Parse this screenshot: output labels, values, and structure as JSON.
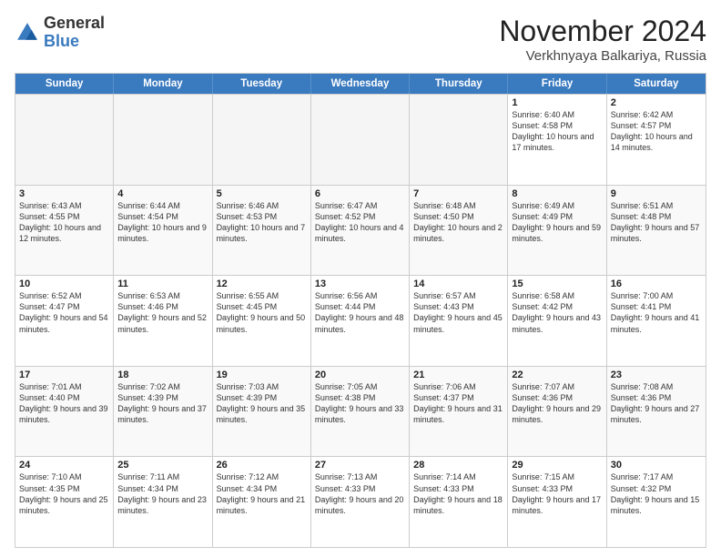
{
  "logo": {
    "general": "General",
    "blue": "Blue"
  },
  "header": {
    "month": "November 2024",
    "location": "Verkhnyaya Balkariya, Russia"
  },
  "weekdays": [
    "Sunday",
    "Monday",
    "Tuesday",
    "Wednesday",
    "Thursday",
    "Friday",
    "Saturday"
  ],
  "weeks": [
    [
      {
        "day": "",
        "info": "",
        "empty": true
      },
      {
        "day": "",
        "info": "",
        "empty": true
      },
      {
        "day": "",
        "info": "",
        "empty": true
      },
      {
        "day": "",
        "info": "",
        "empty": true
      },
      {
        "day": "",
        "info": "",
        "empty": true
      },
      {
        "day": "1",
        "info": "Sunrise: 6:40 AM\nSunset: 4:58 PM\nDaylight: 10 hours\nand 17 minutes."
      },
      {
        "day": "2",
        "info": "Sunrise: 6:42 AM\nSunset: 4:57 PM\nDaylight: 10 hours\nand 14 minutes."
      }
    ],
    [
      {
        "day": "3",
        "info": "Sunrise: 6:43 AM\nSunset: 4:55 PM\nDaylight: 10 hours\nand 12 minutes."
      },
      {
        "day": "4",
        "info": "Sunrise: 6:44 AM\nSunset: 4:54 PM\nDaylight: 10 hours\nand 9 minutes."
      },
      {
        "day": "5",
        "info": "Sunrise: 6:46 AM\nSunset: 4:53 PM\nDaylight: 10 hours\nand 7 minutes."
      },
      {
        "day": "6",
        "info": "Sunrise: 6:47 AM\nSunset: 4:52 PM\nDaylight: 10 hours\nand 4 minutes."
      },
      {
        "day": "7",
        "info": "Sunrise: 6:48 AM\nSunset: 4:50 PM\nDaylight: 10 hours\nand 2 minutes."
      },
      {
        "day": "8",
        "info": "Sunrise: 6:49 AM\nSunset: 4:49 PM\nDaylight: 9 hours\nand 59 minutes."
      },
      {
        "day": "9",
        "info": "Sunrise: 6:51 AM\nSunset: 4:48 PM\nDaylight: 9 hours\nand 57 minutes."
      }
    ],
    [
      {
        "day": "10",
        "info": "Sunrise: 6:52 AM\nSunset: 4:47 PM\nDaylight: 9 hours\nand 54 minutes."
      },
      {
        "day": "11",
        "info": "Sunrise: 6:53 AM\nSunset: 4:46 PM\nDaylight: 9 hours\nand 52 minutes."
      },
      {
        "day": "12",
        "info": "Sunrise: 6:55 AM\nSunset: 4:45 PM\nDaylight: 9 hours\nand 50 minutes."
      },
      {
        "day": "13",
        "info": "Sunrise: 6:56 AM\nSunset: 4:44 PM\nDaylight: 9 hours\nand 48 minutes."
      },
      {
        "day": "14",
        "info": "Sunrise: 6:57 AM\nSunset: 4:43 PM\nDaylight: 9 hours\nand 45 minutes."
      },
      {
        "day": "15",
        "info": "Sunrise: 6:58 AM\nSunset: 4:42 PM\nDaylight: 9 hours\nand 43 minutes."
      },
      {
        "day": "16",
        "info": "Sunrise: 7:00 AM\nSunset: 4:41 PM\nDaylight: 9 hours\nand 41 minutes."
      }
    ],
    [
      {
        "day": "17",
        "info": "Sunrise: 7:01 AM\nSunset: 4:40 PM\nDaylight: 9 hours\nand 39 minutes."
      },
      {
        "day": "18",
        "info": "Sunrise: 7:02 AM\nSunset: 4:39 PM\nDaylight: 9 hours\nand 37 minutes."
      },
      {
        "day": "19",
        "info": "Sunrise: 7:03 AM\nSunset: 4:39 PM\nDaylight: 9 hours\nand 35 minutes."
      },
      {
        "day": "20",
        "info": "Sunrise: 7:05 AM\nSunset: 4:38 PM\nDaylight: 9 hours\nand 33 minutes."
      },
      {
        "day": "21",
        "info": "Sunrise: 7:06 AM\nSunset: 4:37 PM\nDaylight: 9 hours\nand 31 minutes."
      },
      {
        "day": "22",
        "info": "Sunrise: 7:07 AM\nSunset: 4:36 PM\nDaylight: 9 hours\nand 29 minutes."
      },
      {
        "day": "23",
        "info": "Sunrise: 7:08 AM\nSunset: 4:36 PM\nDaylight: 9 hours\nand 27 minutes."
      }
    ],
    [
      {
        "day": "24",
        "info": "Sunrise: 7:10 AM\nSunset: 4:35 PM\nDaylight: 9 hours\nand 25 minutes."
      },
      {
        "day": "25",
        "info": "Sunrise: 7:11 AM\nSunset: 4:34 PM\nDaylight: 9 hours\nand 23 minutes."
      },
      {
        "day": "26",
        "info": "Sunrise: 7:12 AM\nSunset: 4:34 PM\nDaylight: 9 hours\nand 21 minutes."
      },
      {
        "day": "27",
        "info": "Sunrise: 7:13 AM\nSunset: 4:33 PM\nDaylight: 9 hours\nand 20 minutes."
      },
      {
        "day": "28",
        "info": "Sunrise: 7:14 AM\nSunset: 4:33 PM\nDaylight: 9 hours\nand 18 minutes."
      },
      {
        "day": "29",
        "info": "Sunrise: 7:15 AM\nSunset: 4:33 PM\nDaylight: 9 hours\nand 17 minutes."
      },
      {
        "day": "30",
        "info": "Sunrise: 7:17 AM\nSunset: 4:32 PM\nDaylight: 9 hours\nand 15 minutes."
      }
    ]
  ]
}
